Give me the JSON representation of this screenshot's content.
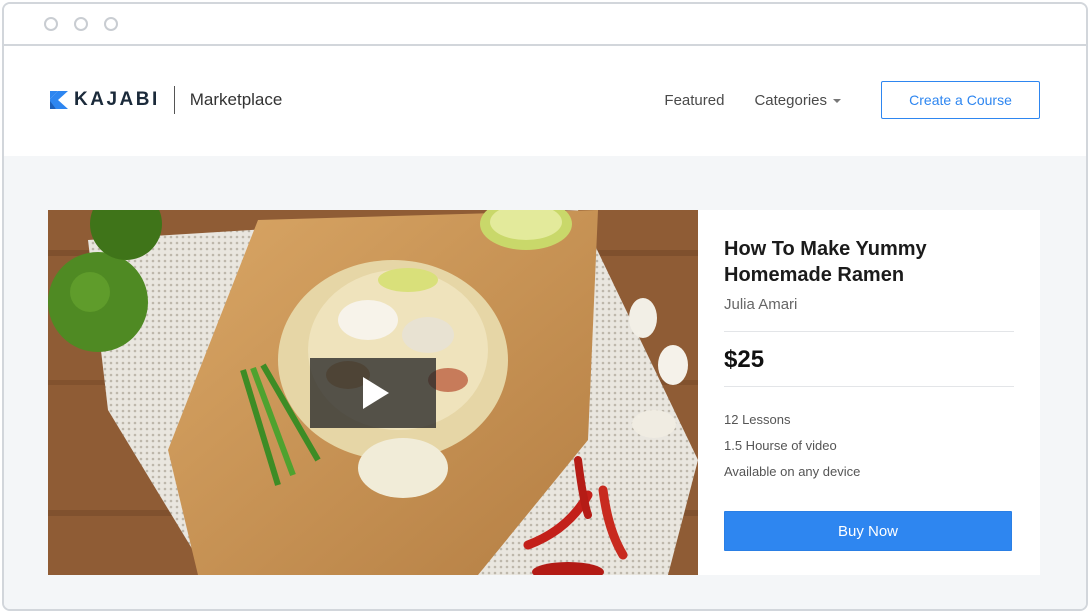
{
  "window": {
    "controls": [
      "close",
      "minimize",
      "maximize"
    ]
  },
  "navbar": {
    "brand": "KAJABI",
    "brand_subtitle": "Marketplace",
    "links": {
      "featured": "Featured",
      "categories": "Categories"
    },
    "cta_label": "Create a Course"
  },
  "course": {
    "title": "How To Make Yummy Homemade Ramen",
    "author": "Julia Amari",
    "price": "$25",
    "features": [
      "12 Lessons",
      "1.5 Hourse of video",
      "Available on any device"
    ],
    "buy_label": "Buy Now"
  },
  "colors": {
    "accent": "#2e86f0",
    "brand_icon": "#2e86f0",
    "content_bg": "#f4f6f8"
  },
  "icons": {
    "logo": "kajabi-logo-icon",
    "play": "play-icon",
    "dropdown": "caret-down-icon"
  }
}
